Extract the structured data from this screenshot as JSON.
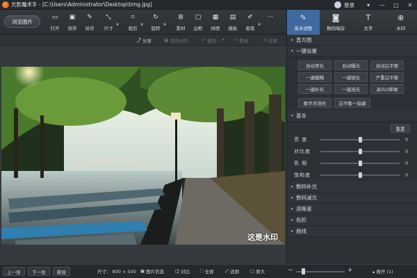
{
  "window": {
    "title": "光影魔术手 - [C:\\Users\\Administrator\\Desktop\\timg.jpg]",
    "login": "登录",
    "controls": [
      "▾",
      "—",
      "□",
      "✕"
    ]
  },
  "toolbar": {
    "browse": "浏览图片",
    "tools": [
      {
        "label": "打开",
        "icon": "folder-icon"
      },
      {
        "label": "保存",
        "icon": "save-icon"
      },
      {
        "label": "另存",
        "icon": "save-as-icon"
      },
      {
        "label": "尺寸",
        "icon": "resize-icon"
      },
      {
        "label": "裁剪",
        "icon": "crop-icon"
      },
      {
        "label": "旋转",
        "icon": "rotate-icon"
      },
      {
        "label": "素材",
        "icon": "material-icon"
      },
      {
        "label": "边框",
        "icon": "border-icon"
      },
      {
        "label": "拼图",
        "icon": "collage-icon"
      },
      {
        "label": "模板",
        "icon": "template-icon"
      },
      {
        "label": "画笔",
        "icon": "brush-icon"
      }
    ],
    "more": "···"
  },
  "actionbar": {
    "share": "分享",
    "save_action": "保存动作",
    "undo": "撤销",
    "redo": "重做",
    "restore": "还原"
  },
  "canvas": {
    "watermark": "这是水印"
  },
  "statusbar": {
    "prev": "上一张",
    "next": "下一张",
    "delete": "删除",
    "size": "尺寸： 800 × 500",
    "info": "图片信息",
    "compare": "对比",
    "fullscreen": "全屏",
    "fit": "适屏",
    "original": "原大",
    "expand": "展开 (1)",
    "zoom_fraction": 0.15
  },
  "panel": {
    "tabs": [
      {
        "label": "基本调整",
        "icon": "adjust-icon"
      },
      {
        "label": "数码暗房",
        "icon": "darkroom-icon"
      },
      {
        "label": "文字",
        "icon": "text-icon"
      },
      {
        "label": "水印",
        "icon": "watermark-icon"
      }
    ],
    "sections": {
      "histogram": "直方图",
      "one_click": "一键设置",
      "basic": "基本",
      "digital_fill": "数码补光",
      "digital_reduce": "数码减光",
      "sharpness": "清晰度",
      "levels": "色阶",
      "curves": "曲线"
    },
    "one_click_buttons": [
      "自动美化",
      "自动曝光",
      "自动白平衡",
      "一键模糊",
      "一键锐化",
      "严重白平衡",
      "一键补光",
      "一键减光",
      "高ISO降噪"
    ],
    "extra_buttons": [
      "数字点测光",
      "白平衡一指键"
    ],
    "reset": "重置",
    "sliders": [
      {
        "name": "亮 度",
        "value": 0,
        "fraction": 0.5
      },
      {
        "name": "对比度",
        "value": 0,
        "fraction": 0.5
      },
      {
        "name": "色 相",
        "value": 0,
        "fraction": 0.5
      },
      {
        "name": "饱和度",
        "value": 0,
        "fraction": 0.5
      }
    ]
  },
  "colors": {
    "accent": "#3f6aa1",
    "background": "#2b2e33"
  }
}
